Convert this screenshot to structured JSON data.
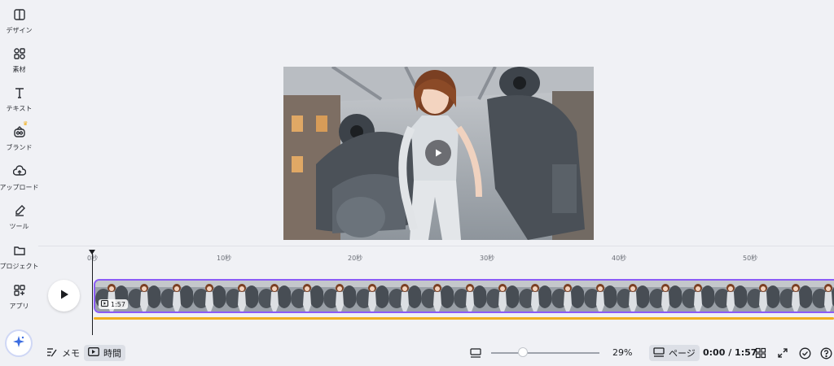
{
  "sidebar": {
    "items": [
      {
        "label": "デザイン",
        "icon": "design-icon"
      },
      {
        "label": "素材",
        "icon": "elements-icon"
      },
      {
        "label": "テキスト",
        "icon": "text-icon"
      },
      {
        "label": "ブランド",
        "icon": "brand-icon"
      },
      {
        "label": "アップロード",
        "icon": "upload-icon"
      },
      {
        "label": "ツール",
        "icon": "tools-icon"
      },
      {
        "label": "プロジェクト",
        "icon": "folder-icon"
      },
      {
        "label": "アプリ",
        "icon": "apps-icon"
      }
    ],
    "magic_icon": "magic-sparkle-icon"
  },
  "timeline": {
    "ticks": [
      "0秒",
      "10秒",
      "20秒",
      "30秒",
      "40秒",
      "50秒"
    ],
    "clip_duration": "1:57"
  },
  "bottom_bar": {
    "memo_label": "メモ",
    "time_label": "時間",
    "zoom_level": "29%",
    "zoom_fraction": 0.29,
    "page_label": "ページ",
    "time_display": "0:00 / 1:57"
  },
  "colors": {
    "accent": "#8b5cf6",
    "audio": "#f2b01e",
    "background": "#f0f1f5"
  }
}
